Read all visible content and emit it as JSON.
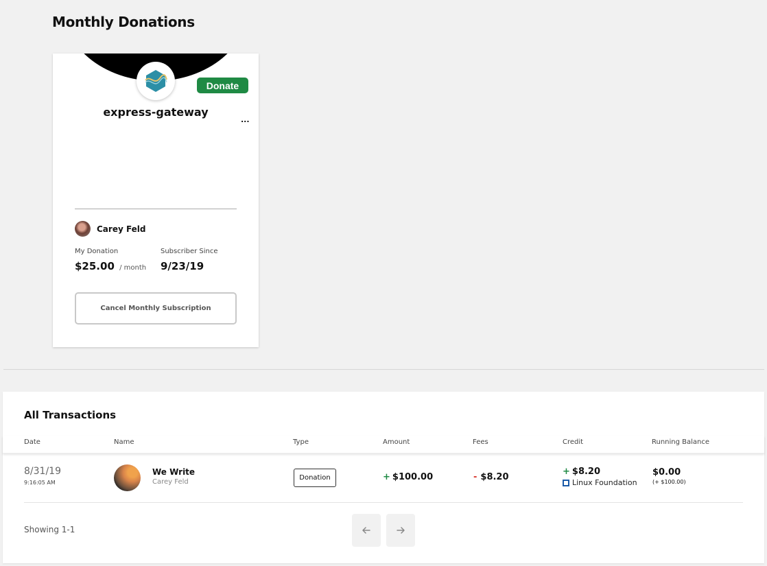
{
  "page": {
    "title": "Monthly Donations"
  },
  "donation_card": {
    "org_name": "express-gateway",
    "donate_label": "Donate",
    "ellipsis": "...",
    "donor_name": "Carey Feld",
    "my_donation_label": "My Donation",
    "my_donation_value": "$25.00",
    "my_donation_suffix": "/ month",
    "subscriber_since_label": "Subscriber Since",
    "subscriber_since_value": "9/23/19",
    "cancel_label": "Cancel Monthly Subscription",
    "colors": {
      "donate_badge": "#1f8a44"
    }
  },
  "transactions": {
    "title": "All Transactions",
    "columns": [
      "Date",
      "Name",
      "Type",
      "Amount",
      "Fees",
      "Credit",
      "Running Balance"
    ],
    "rows": [
      {
        "date": "8/31/19",
        "time": "9:16:05 AM",
        "name": "We Write",
        "sub_name": "Carey Feld",
        "type": "Donation",
        "amount_sign": "+",
        "amount": "$100.00",
        "fees_sign": "-",
        "fees": "$8.20",
        "credit_sign": "+",
        "credit": "$8.20",
        "credit_org": "Linux Foundation",
        "balance": "$0.00",
        "balance_delta": "(+ $100.00)"
      }
    ],
    "showing": "Showing 1-1",
    "prev_icon": "arrow-left-icon",
    "next_icon": "arrow-right-icon"
  }
}
